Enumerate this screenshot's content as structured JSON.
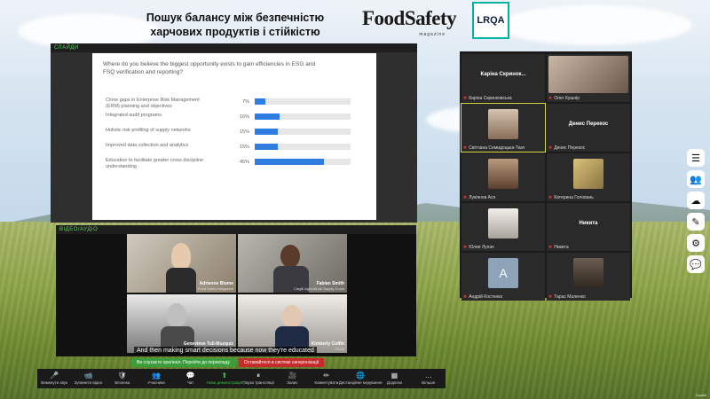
{
  "header": {
    "title_line1": "Пошук балансу між безпечністю",
    "title_line2": "харчових продуктів і стійкістю",
    "logo_word": "FoodSafety",
    "logo_sub": "magazine",
    "logo_lrqa": "LRQA"
  },
  "slides": {
    "window_label": "СЛАЙДИ",
    "question": "Where do you believe the biggest opportunity exists to gain efficiencies in ESG and FSQ verification and reporting?",
    "options": [
      {
        "label": "Close gaps in Enterprise Risk Management (ERM) planning and objectives",
        "pct": "7%",
        "value": 7
      },
      {
        "label": "Integrated audit programs",
        "pct": "16%",
        "value": 16
      },
      {
        "label": "Holistic risk profiling of supply networks",
        "pct": "15%",
        "value": 15
      },
      {
        "label": "Improved data collection and analytics",
        "pct": "15%",
        "value": 15
      },
      {
        "label": "Education to facilitate greater cross discipline understanding",
        "pct": "45%",
        "value": 45
      }
    ]
  },
  "video": {
    "window_label": "ВІДЕО/АУДІО",
    "tiles": [
      {
        "name": "Adrienne Blume",
        "org": "Food Safety Magazine"
      },
      {
        "name": "Fabian Smith",
        "org": "Cargill Agricultural Supply Chain"
      },
      {
        "name": "Genevieve Tull-Muzquiz",
        "org": "Company"
      },
      {
        "name": "Kimberly Coffin",
        "org": "LRQA"
      }
    ],
    "caption": "And then making smart decisions because now they're educated"
  },
  "participants": [
    {
      "big": "Каріна Скринок...",
      "small": "Каріна Скринковська"
    },
    {
      "big": "",
      "small": "Олег Кушнір"
    },
    {
      "big": "",
      "small": "Світлана Семидоцька-Ткач"
    },
    {
      "big": "Денис Перекос",
      "small": "Денис Перекос"
    },
    {
      "big": "",
      "small": "Лукіянов Ася"
    },
    {
      "big": "",
      "small": "Катерина Головань"
    },
    {
      "big": "",
      "small": "Юлия Лупач"
    },
    {
      "big": "Никита",
      "small": "Никита"
    },
    {
      "big": "",
      "small": "Андрій Костенко"
    },
    {
      "big": "",
      "small": "Тарас Маленко"
    }
  ],
  "recording": {
    "green": "Ви слухаєте оригінал. Перейти до перекладу",
    "red": "Оставайтеся в системі синхронізації"
  },
  "toolbar": [
    {
      "icon": "🎤",
      "label": "Вимкнути звук"
    },
    {
      "icon": "📹",
      "label": "Зупинити відео"
    },
    {
      "icon": "🛡",
      "label": "Безпека"
    },
    {
      "icon": "👥",
      "label": "Учасники"
    },
    {
      "icon": "💬",
      "label": "Чат"
    },
    {
      "icon": "⬆",
      "label": "Нова демонстрація"
    },
    {
      "icon": "⏸",
      "label": "Пауза трансляції"
    },
    {
      "icon": "🎥",
      "label": "Запис"
    },
    {
      "icon": "✏",
      "label": "Коментувати"
    },
    {
      "icon": "🌐",
      "label": "Дистанційне керування"
    },
    {
      "icon": "▦",
      "label": "Додатки"
    },
    {
      "icon": "…",
      "label": "Більше"
    }
  ],
  "corner_text": "Хронік",
  "colors": {
    "accent_bar": "#2f7de1",
    "lrqa_border": "#00b3a4",
    "mic_muted": "#e03030"
  }
}
